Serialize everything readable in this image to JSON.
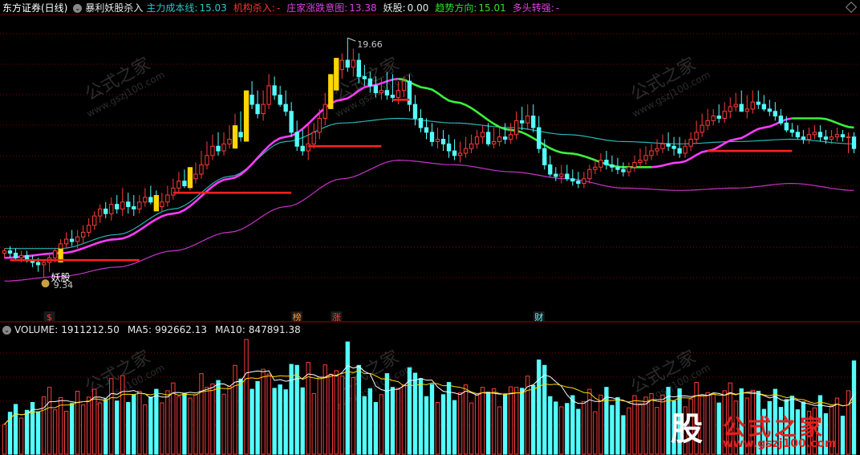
{
  "header": {
    "stock": "东方证券(日线)",
    "indicator": "暴利妖股杀入",
    "items": [
      {
        "label": "主力成本线:",
        "value": "15.03",
        "color": "#28c8c8"
      },
      {
        "label": "机构杀入:",
        "value": "-",
        "color": "#ff3030"
      },
      {
        "label": "庄家涨跌意图:",
        "value": "13.38",
        "color": "#e040e0"
      },
      {
        "label": "妖股:",
        "value": "0.00",
        "color": "#e8e8e8"
      },
      {
        "label": "趋势方向:",
        "value": "15.01",
        "color": "#30e030"
      },
      {
        "label": "多头转强:",
        "value": "-",
        "color": "#e040e0"
      }
    ]
  },
  "volume_header": {
    "volume_label": "VOLUME:",
    "volume_value": "1911212.50",
    "ma5_label": "MA5:",
    "ma5_value": "992662.13",
    "ma10_label": "MA10:",
    "ma10_value": "847891.38"
  },
  "watermark": {
    "name": "公式之家",
    "url": "www.gszj100.com"
  },
  "logo": {
    "seal": "股",
    "name": "公式之家",
    "url": "www.gszj100.com"
  },
  "colors": {
    "up": "#ff3c3c",
    "down": "#54ffff",
    "magenta": "#ff3cff",
    "green": "#3cf03c",
    "cyan_line": "#28b4b4",
    "purple_line": "#c832c8",
    "yellow": "#ffd700",
    "grid": "#8a0000",
    "text_gray": "#c8c8c8"
  },
  "chart_data": [
    {
      "type": "candlestick",
      "title": "东方证券(日线)",
      "ylim": [
        8.0,
        20.6
      ],
      "x_count": 152,
      "max_label": "19.66",
      "min_label": "9.34",
      "signal_label": "妖股",
      "markers": [
        {
          "label": "$",
          "x": 8,
          "color": "#ff3c3c"
        },
        {
          "label": "榜",
          "x": 52,
          "color": "#ff9a3c"
        },
        {
          "label": "涨",
          "x": 59,
          "color": "#ff3c3c"
        },
        {
          "label": "财",
          "x": 95,
          "color": "#54ffff"
        }
      ],
      "candles": {
        "open": [
          10.4,
          10.5,
          10.4,
          10.2,
          10.3,
          10.1,
          10.0,
          9.9,
          10.0,
          10.2,
          10.5,
          10.8,
          11.0,
          10.9,
          11.1,
          11.3,
          11.6,
          12.0,
          12.3,
          12.1,
          12.5,
          12.3,
          12.6,
          12.4,
          12.3,
          12.6,
          12.8,
          12.6,
          12.4,
          12.6,
          12.9,
          13.2,
          13.5,
          13.3,
          13.6,
          13.8,
          14.2,
          14.6,
          15.0,
          14.8,
          15.1,
          15.3,
          15.6,
          15.4,
          17.2,
          16.8,
          16.4,
          16.8,
          17.6,
          17.2,
          16.8,
          16.5,
          15.6,
          15.0,
          14.8,
          15.1,
          15.6,
          16.2,
          16.8,
          17.6,
          18.3,
          18.7,
          18.4,
          18.7,
          18.0,
          17.9,
          17.6,
          17.3,
          17.4,
          17.2,
          17.1,
          17.4,
          17.8,
          16.8,
          16.2,
          15.8,
          15.6,
          15.2,
          15.3,
          15.1,
          14.8,
          14.6,
          14.7,
          14.9,
          15.1,
          15.4,
          15.6,
          15.1,
          15.2,
          15.4,
          15.3,
          15.5,
          16.1,
          16.0,
          16.3,
          15.8,
          14.9,
          14.2,
          13.8,
          13.7,
          13.8,
          13.6,
          13.5,
          13.4,
          13.6,
          14.0,
          14.1,
          14.4,
          14.2,
          14.1,
          14.0,
          13.9,
          14.1,
          14.3,
          14.4,
          14.6,
          14.8,
          14.9,
          15.1,
          15.0,
          14.9,
          14.7,
          15.0,
          15.3,
          15.6,
          15.9,
          16.1,
          16.3,
          16.2,
          16.5,
          16.7,
          16.8,
          16.5,
          16.6,
          16.9,
          16.8,
          16.6,
          16.5,
          16.3,
          16.0,
          15.7,
          15.6,
          15.4,
          15.3,
          15.5,
          15.6,
          15.4,
          15.3,
          15.4,
          15.5,
          15.4,
          15.4
        ],
        "high": [
          10.6,
          10.7,
          10.6,
          10.5,
          10.5,
          10.3,
          10.2,
          10.1,
          10.4,
          10.6,
          11.0,
          11.3,
          11.4,
          11.4,
          11.6,
          11.9,
          12.2,
          12.5,
          12.6,
          12.8,
          12.9,
          13.2,
          13.0,
          12.9,
          12.9,
          13.2,
          13.3,
          13.1,
          13.0,
          13.3,
          13.6,
          13.9,
          14.0,
          14.1,
          14.3,
          14.8,
          15.2,
          15.5,
          15.6,
          15.6,
          15.9,
          16.4,
          16.5,
          17.4,
          17.8,
          17.4,
          17.4,
          18.1,
          18.0,
          17.6,
          17.4,
          16.9,
          16.1,
          15.7,
          15.9,
          16.0,
          16.6,
          17.3,
          18.1,
          18.8,
          19.0,
          19.66,
          19.2,
          19.0,
          18.5,
          18.2,
          18.0,
          17.9,
          18.2,
          18.1,
          17.8,
          18.0,
          18.1,
          17.2,
          16.6,
          16.2,
          16.0,
          15.8,
          15.7,
          15.5,
          15.3,
          15.2,
          15.4,
          15.5,
          15.7,
          15.9,
          16.0,
          15.8,
          15.8,
          16.0,
          16.0,
          16.5,
          16.7,
          16.8,
          16.8,
          16.3,
          15.3,
          14.6,
          14.1,
          14.2,
          14.2,
          14.0,
          13.9,
          13.9,
          14.2,
          14.4,
          14.7,
          14.8,
          14.6,
          14.5,
          14.3,
          14.3,
          14.6,
          14.9,
          15.0,
          15.1,
          15.3,
          15.5,
          15.6,
          15.4,
          15.4,
          15.3,
          15.6,
          16.1,
          16.4,
          16.6,
          16.6,
          16.8,
          16.9,
          17.1,
          17.3,
          17.4,
          17.2,
          17.4,
          17.4,
          17.2,
          17.0,
          16.9,
          16.6,
          16.3,
          16.0,
          15.9,
          15.7,
          15.8,
          15.9,
          15.9,
          15.7,
          15.7,
          15.8,
          15.7,
          15.6,
          15.6
        ],
        "low": [
          10.2,
          10.2,
          10.1,
          10.0,
          10.0,
          9.8,
          9.6,
          9.34,
          9.6,
          10.0,
          10.3,
          10.6,
          10.7,
          10.6,
          10.8,
          11.1,
          11.4,
          11.7,
          11.9,
          11.8,
          12.1,
          12.0,
          12.1,
          12.0,
          12.1,
          12.4,
          12.5,
          12.3,
          12.2,
          12.4,
          12.7,
          13.0,
          13.2,
          13.1,
          13.4,
          13.6,
          14.0,
          14.4,
          14.6,
          14.6,
          14.9,
          15.1,
          15.2,
          15.2,
          16.6,
          16.2,
          16.1,
          16.6,
          17.0,
          16.7,
          16.3,
          15.4,
          14.8,
          14.6,
          14.4,
          14.9,
          15.3,
          15.9,
          16.6,
          17.4,
          17.9,
          18.2,
          18.0,
          17.7,
          17.6,
          17.3,
          17.1,
          17.0,
          17.0,
          16.9,
          16.8,
          17.1,
          16.5,
          15.9,
          15.6,
          15.3,
          15.0,
          14.9,
          14.8,
          14.5,
          14.4,
          14.3,
          14.5,
          14.7,
          14.9,
          15.1,
          15.0,
          14.9,
          15.0,
          15.1,
          15.1,
          15.3,
          15.7,
          15.7,
          15.6,
          14.7,
          14.0,
          13.7,
          13.5,
          13.4,
          13.5,
          13.3,
          13.2,
          13.2,
          13.4,
          13.8,
          13.9,
          14.0,
          13.9,
          13.8,
          13.7,
          13.7,
          13.9,
          14.1,
          14.2,
          14.4,
          14.6,
          14.7,
          14.8,
          14.6,
          14.5,
          14.5,
          14.8,
          15.1,
          15.4,
          15.7,
          15.9,
          16.0,
          16.0,
          16.2,
          16.5,
          16.5,
          16.2,
          16.4,
          16.6,
          16.5,
          16.3,
          16.1,
          15.9,
          15.6,
          15.4,
          15.3,
          15.1,
          15.1,
          15.3,
          15.2,
          15.1,
          15.1,
          15.2,
          15.2,
          14.7,
          14.7
        ],
        "close": [
          10.5,
          10.4,
          10.2,
          10.3,
          10.1,
          10.0,
          9.9,
          10.0,
          10.2,
          10.5,
          10.8,
          11.0,
          10.9,
          11.1,
          11.3,
          11.6,
          12.0,
          12.3,
          12.1,
          12.5,
          12.3,
          12.6,
          12.4,
          12.3,
          12.6,
          12.8,
          12.6,
          12.4,
          12.6,
          12.9,
          13.2,
          13.5,
          13.3,
          13.6,
          13.8,
          14.2,
          14.6,
          15.0,
          14.8,
          15.1,
          15.3,
          15.6,
          15.4,
          17.2,
          16.8,
          16.4,
          16.8,
          17.6,
          17.2,
          16.8,
          16.5,
          15.6,
          15.0,
          14.8,
          15.1,
          15.6,
          16.2,
          16.8,
          17.6,
          18.3,
          18.7,
          18.4,
          18.7,
          18.0,
          17.9,
          17.6,
          17.3,
          17.4,
          17.2,
          17.1,
          17.4,
          17.8,
          16.8,
          16.2,
          15.8,
          15.6,
          15.2,
          15.3,
          15.1,
          14.8,
          14.6,
          14.7,
          14.9,
          15.1,
          15.4,
          15.6,
          15.1,
          15.2,
          15.4,
          15.3,
          15.5,
          16.1,
          16.0,
          16.3,
          15.8,
          14.9,
          14.2,
          13.8,
          13.7,
          13.8,
          13.6,
          13.5,
          13.4,
          13.6,
          14.0,
          14.1,
          14.4,
          14.2,
          14.1,
          14.0,
          13.9,
          14.1,
          14.3,
          14.4,
          14.6,
          14.8,
          14.9,
          15.1,
          15.0,
          14.9,
          14.7,
          15.0,
          15.3,
          15.6,
          15.9,
          16.1,
          16.3,
          16.2,
          16.5,
          16.7,
          16.8,
          16.5,
          16.6,
          16.9,
          16.8,
          16.6,
          16.5,
          16.3,
          16.0,
          15.7,
          15.6,
          15.4,
          15.3,
          15.5,
          15.6,
          15.4,
          15.3,
          15.4,
          15.5,
          15.4,
          15.4,
          14.9
        ]
      },
      "yellow_bars": [
        [
          10,
          10.0,
          10.6
        ],
        [
          27,
          12.2,
          12.9
        ],
        [
          33,
          13.2,
          14.1
        ],
        [
          41,
          14.9,
          15.9
        ],
        [
          43,
          15.2,
          17.4
        ],
        [
          58,
          16.6,
          18.1
        ],
        [
          59,
          17.4,
          18.8
        ]
      ],
      "red_segments": [
        [
          1,
          10,
          24,
          10.1
        ],
        [
          30,
          51,
          13.0
        ],
        [
          54,
          67,
          15.0
        ],
        [
          69,
          72,
          17.0
        ],
        [
          125,
          140,
          14.8
        ]
      ],
      "series": [
        {
          "role": "main_cost",
          "color": "#28b4b4",
          "values_anchor": [
            [
              0,
              10.6
            ],
            [
              10,
              10.6
            ],
            [
              20,
              11.2
            ],
            [
              30,
              12.3
            ],
            [
              40,
              13.7
            ],
            [
              50,
              15.2
            ],
            [
              60,
              16.0
            ],
            [
              70,
              16.2
            ],
            [
              80,
              16.0
            ],
            [
              90,
              15.8
            ],
            [
              100,
              15.5
            ],
            [
              110,
              15.2
            ],
            [
              120,
              15.1
            ],
            [
              130,
              15.2
            ],
            [
              140,
              15.3
            ],
            [
              151,
              15.1
            ]
          ]
        },
        {
          "role": "trend_magenta",
          "color": "#ff3cff",
          "values_anchor": [
            [
              0,
              10.2
            ],
            [
              10,
              10.4
            ],
            [
              20,
              11.0
            ],
            [
              30,
              12.1
            ],
            [
              40,
              13.6
            ],
            [
              50,
              15.4
            ],
            [
              60,
              17.0
            ],
            [
              65,
              17.6
            ],
            [
              70,
              17.9
            ]
          ]
        },
        {
          "role": "trend_green",
          "color": "#3cf03c",
          "values_anchor": [
            [
              70,
              17.9
            ],
            [
              75,
              17.5
            ],
            [
              80,
              16.9
            ],
            [
              90,
              15.7
            ],
            [
              100,
              14.7
            ],
            [
              110,
              14.1
            ],
            [
              115,
              14.1
            ]
          ]
        },
        {
          "role": "trend_magenta_2",
          "color": "#ff3cff",
          "values_anchor": [
            [
              115,
              14.1
            ],
            [
              120,
              14.3
            ],
            [
              125,
              14.8
            ],
            [
              130,
              15.3
            ],
            [
              135,
              15.8
            ],
            [
              140,
              16.2
            ]
          ]
        },
        {
          "role": "trend_green_2",
          "color": "#3cf03c",
          "values_anchor": [
            [
              140,
              16.2
            ],
            [
              145,
              16.2
            ],
            [
              151,
              15.8
            ]
          ]
        },
        {
          "role": "slow_purple",
          "color": "#c832c8",
          "values_anchor": [
            [
              0,
              9.2
            ],
            [
              10,
              9.4
            ],
            [
              20,
              9.8
            ],
            [
              30,
              10.5
            ],
            [
              40,
              11.3
            ],
            [
              50,
              12.4
            ],
            [
              60,
              13.6
            ],
            [
              70,
              14.4
            ],
            [
              80,
              14.2
            ],
            [
              90,
              13.9
            ],
            [
              100,
              13.6
            ],
            [
              110,
              13.2
            ],
            [
              120,
              13.1
            ],
            [
              130,
              13.2
            ],
            [
              140,
              13.4
            ],
            [
              151,
              13.1
            ]
          ]
        }
      ]
    },
    {
      "type": "bar",
      "title": "VOLUME",
      "ylim": [
        0,
        2400000
      ],
      "values_count": 152,
      "last_value": 1911212.5,
      "ma5_last": 992662.13,
      "ma10_last": 847891.38
    }
  ]
}
